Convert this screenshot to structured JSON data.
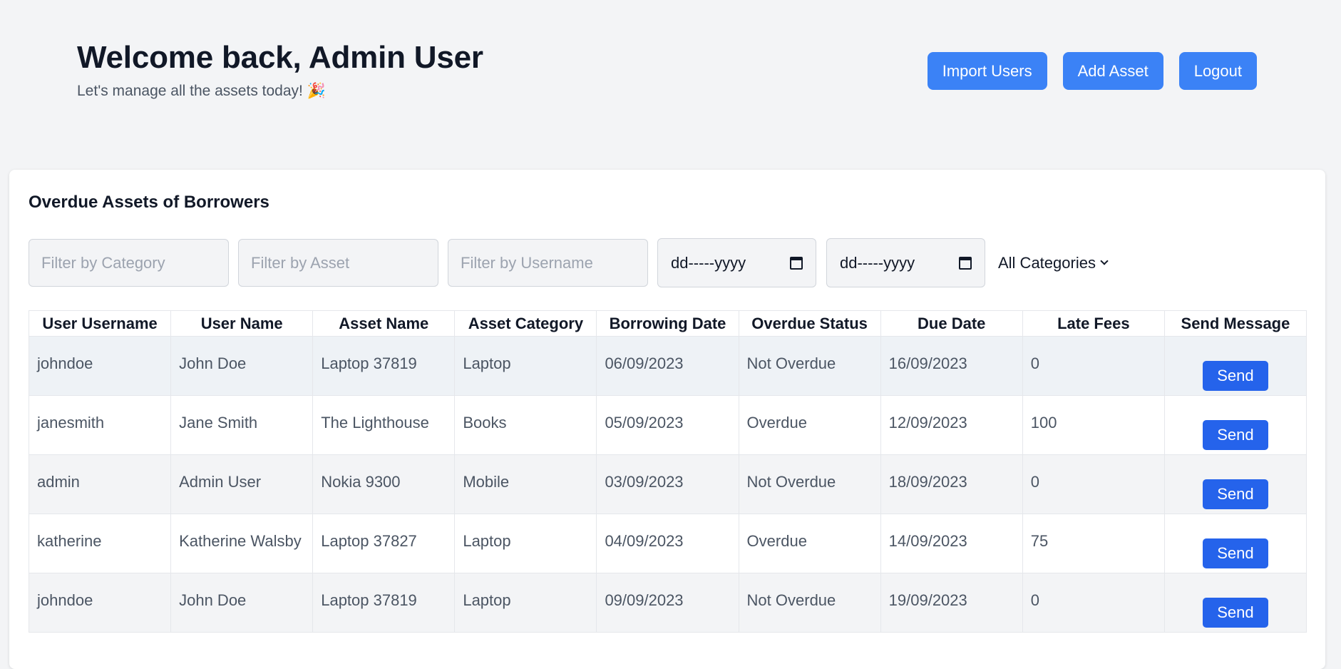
{
  "header": {
    "title": "Welcome back, Admin User",
    "subtitle": "Let's manage all the assets today! 🎉",
    "buttons": [
      "Import Users",
      "Add Asset",
      "Logout"
    ]
  },
  "card": {
    "title": "Overdue Assets of Borrowers",
    "filters": {
      "category_placeholder": "Filter by Category",
      "asset_placeholder": "Filter by Asset",
      "username_placeholder": "Filter by Username",
      "date_from": "dd-----yyyy",
      "date_to": "dd-----yyyy",
      "category_select": "All Categories"
    },
    "columns": [
      "User Username",
      "User Name",
      "Asset Name",
      "Asset Category",
      "Borrowing Date",
      "Overdue Status",
      "Due Date",
      "Late Fees",
      "Send Message"
    ],
    "rows": [
      [
        "johndoe",
        "John Doe",
        "Laptop 37819",
        "Laptop",
        "06/09/2023",
        "Not Overdue",
        "16/09/2023",
        "0"
      ],
      [
        "janesmith",
        "Jane Smith",
        "The Lighthouse",
        "Books",
        "05/09/2023",
        "Overdue",
        "12/09/2023",
        "100"
      ],
      [
        "admin",
        "Admin User",
        "Nokia 9300",
        "Mobile",
        "03/09/2023",
        "Not Overdue",
        "18/09/2023",
        "0"
      ],
      [
        "katherine",
        "Katherine Walsby",
        "Laptop 37827",
        "Laptop",
        "04/09/2023",
        "Overdue",
        "14/09/2023",
        "75"
      ],
      [
        "johndoe",
        "John Doe",
        "Laptop 37819",
        "Laptop",
        "09/09/2023",
        "Not Overdue",
        "19/09/2023",
        "0"
      ]
    ],
    "send_label": "Send"
  }
}
